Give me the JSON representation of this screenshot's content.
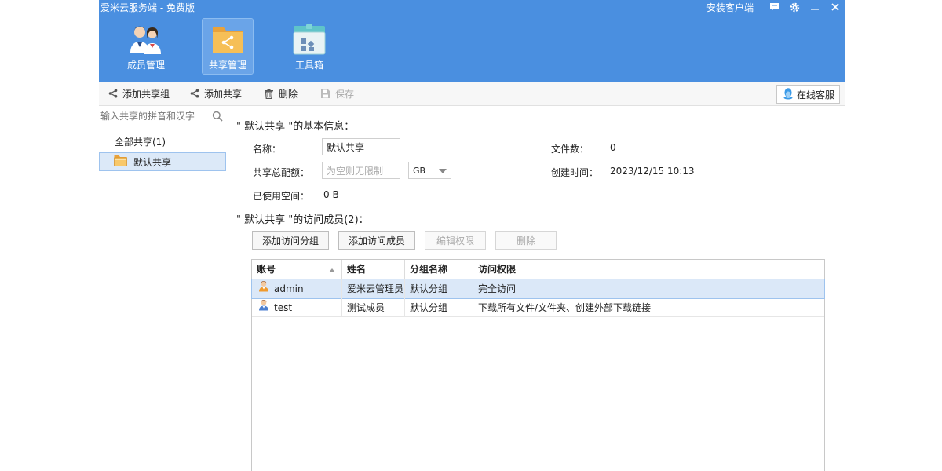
{
  "window": {
    "title": "爱米云服务端 - 免费版",
    "install_client": "安装客户端"
  },
  "nav": {
    "items": [
      {
        "label": "成员管理"
      },
      {
        "label": "共享管理"
      },
      {
        "label": "工具箱"
      }
    ],
    "active_index": 1
  },
  "toolbar": {
    "add_share_group": "添加共享组",
    "add_share": "添加共享",
    "delete": "删除",
    "save": "保存",
    "online_service": "在线客服"
  },
  "left": {
    "search_placeholder": "输入共享的拼音和汉字",
    "all_shares": "全部共享(1)",
    "items": [
      {
        "label": "默认共享"
      }
    ]
  },
  "basic_info": {
    "title": "\" 默认共享 \"的基本信息：",
    "name_label": "名称：",
    "name_value": "默认共享",
    "quota_label": "共享总配额：",
    "quota_placeholder": "为空则无限制",
    "quota_unit": "GB",
    "used_label": "已使用空间：",
    "used_value": "0 B",
    "file_count_label": "文件数：",
    "file_count_value": "0",
    "created_label": "创建时间：",
    "created_value": "2023/12/15 10:13"
  },
  "members": {
    "title": "\" 默认共享 \"的访问成员(2)：",
    "buttons": {
      "add_group": "添加访问分组",
      "add_member": "添加访问成员",
      "edit_perm": "编辑权限",
      "delete": "删除"
    },
    "columns": [
      "账号",
      "姓名",
      "分组名称",
      "访问权限"
    ],
    "rows": [
      {
        "account": "admin",
        "name": "爱米云管理员",
        "group": "默认分组",
        "permission": "完全访问"
      },
      {
        "account": "test",
        "name": "测试成员",
        "group": "默认分组",
        "permission": "下载所有文件/文件夹、创建外部下载链接"
      }
    ]
  },
  "colors": {
    "header_bg": "#4a8fe0",
    "selection_bg": "#dbe8f8"
  }
}
